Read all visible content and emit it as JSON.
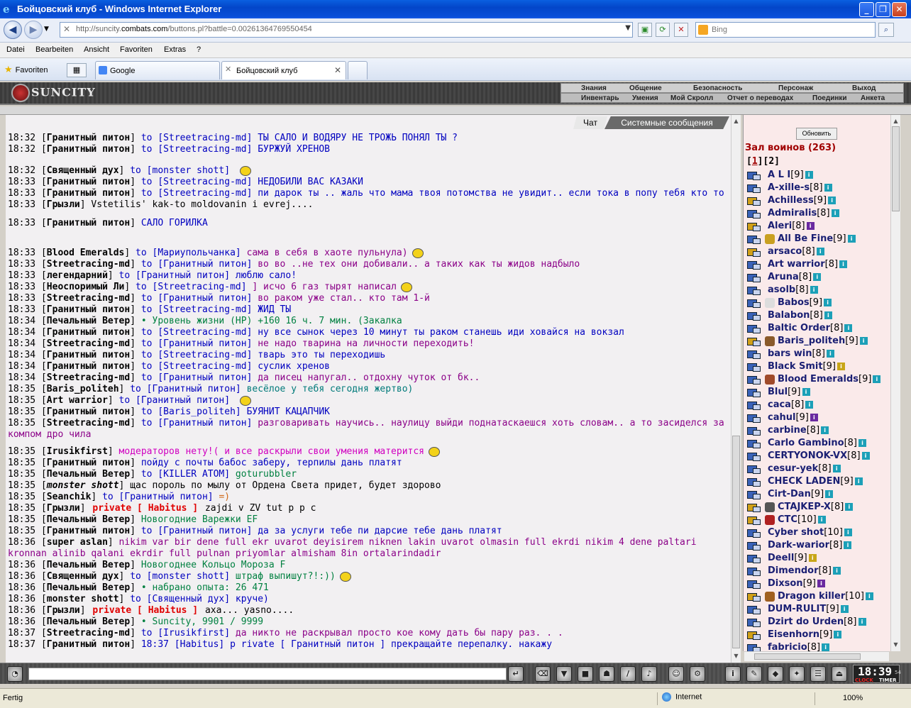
{
  "window": {
    "title": "Бойцовский клуб - Windows Internet Explorer",
    "minimize": "_",
    "maximize": "❐",
    "close": "✕"
  },
  "nav": {
    "back": "◀",
    "forward": "▶",
    "url_prefix": "http://suncity.",
    "url_domain": "combats.com",
    "url_rest": "/buttons.pl?battle=0.00261364769550454",
    "search_placeholder": "Bing"
  },
  "menu": [
    "Datei",
    "Bearbeiten",
    "Ansicht",
    "Favoriten",
    "Extras",
    "?"
  ],
  "favorites_label": "Favoriten",
  "tabs": [
    {
      "label": "Google"
    },
    {
      "label": "Бойцовский клуб"
    }
  ],
  "game": {
    "logo": "SUNCITY",
    "top_menu": [
      "Знания",
      "Общение",
      "Безопасность",
      "Персонаж",
      "Выход"
    ],
    "sub_menu": [
      "Инвентарь",
      "Умения",
      "Мой Скролл",
      "Отчет о переводах",
      "Поединки",
      "Анкета"
    ]
  },
  "chat_tabs": [
    "Чат",
    "Системные сообщения"
  ],
  "chat": [
    {
      "time": "18:32",
      "nick": "Гранитный питон",
      "to": "to [Streetracing-md]",
      "text": "ТЫ САЛО И ВОДЯРУ НЕ ТРОЖЬ ПОНЯЛ ТЫ ?",
      "color": "c-blue"
    },
    {
      "time": "18:32",
      "nick": "Гранитный питон",
      "to": "to [Streetracing-md]",
      "text": "БУРЖУЙ ХРЕНОВ",
      "color": "c-blue"
    },
    {
      "time": "18:32",
      "nick": "Священный дух",
      "to": "to [monster shott]",
      "text": "",
      "color": "c-green"
    },
    {
      "time": "18:33",
      "nick": "Гранитный питон",
      "to": "to [Streetracing-md]",
      "text": "НЕДОБИЛИ ВАС КАЗАКИ",
      "color": "c-blue"
    },
    {
      "time": "18:33",
      "nick": "Гранитный питон",
      "to": "to [Streetracing-md]",
      "text": "пи дарок ты .. жаль что мама твоя потомства не увидит.. если тока в попу тебя кто то",
      "color": "c-blue"
    },
    {
      "time": "18:33",
      "nick": "Грызли",
      "to": "",
      "text": "Vstetilis' kak-to moldovanin i evrej....",
      "color": ""
    },
    {
      "time": "18:33",
      "nick": "Гранитный питон",
      "to": "",
      "text": "САЛО          ГОРИЛКА",
      "color": "c-blue"
    },
    {
      "time": "18:33",
      "nick": "Blood Emeralds",
      "to": "to [Мариупольчанка]",
      "text": "сама в себя в хаоте пульнула)",
      "color": "c-purple"
    },
    {
      "time": "18:33",
      "nick": "Streetracing-md",
      "to": "to [Гранитный питон]",
      "text": "во во ..не тех они добивали.. а таких как ты жидов надбыло",
      "color": "c-purple"
    },
    {
      "time": "18:33",
      "nick": "легендарний",
      "to": "to [Гранитный питон]",
      "text": "люблю сало!",
      "color": "c-blue"
    },
    {
      "time": "18:33",
      "nick": "Неоспоримый Ли",
      "to": "to [Streetracing-md]",
      "text": "] исчо 6 газ тырят написал",
      "color": "c-purple"
    },
    {
      "time": "18:33",
      "nick": "Streetracing-md",
      "to": "to [Гранитный питон]",
      "text": "во раком уже стал.. кто там 1-й",
      "color": "c-purple"
    },
    {
      "time": "18:33",
      "nick": "Гранитный питон",
      "to": "to [Streetracing-md]",
      "text": "ЖИД ТЫ",
      "color": "c-blue"
    },
    {
      "time": "18:34",
      "nick": "Печальный Ветер",
      "to": "",
      "text": "• Уровень жизни (HP) +160 16 ч. 7 мин. (Закалка",
      "color": "c-green"
    },
    {
      "time": "18:34",
      "nick": "Гранитный питон",
      "to": "to [Streetracing-md]",
      "text": "ну все сынок через 10 минут ты раком станешь иди ховайся на вокзал",
      "color": "c-blue"
    },
    {
      "time": "18:34",
      "nick": "Streetracing-md",
      "to": "to [Гранитный питон]",
      "text": "не надо тварина на личности переходить!",
      "color": "c-purple"
    },
    {
      "time": "18:34",
      "nick": "Гранитный питон",
      "to": "to [Streetracing-md]",
      "text": "тварь это ты переходишь",
      "color": "c-blue"
    },
    {
      "time": "18:34",
      "nick": "Гранитный питон",
      "to": "to [Streetracing-md]",
      "text": "суслик хренов",
      "color": "c-blue"
    },
    {
      "time": "18:34",
      "nick": "Streetracing-md",
      "to": "to [Гранитный питон]",
      "text": "да писец напугал.. отдохну чуток от бк..",
      "color": "c-purple"
    },
    {
      "time": "18:35",
      "nick": "Baris_politeh",
      "to": "to [Гранитный питон]",
      "text": "весёлое у тебя сегодня жертво)",
      "color": "c-teal"
    },
    {
      "time": "18:35",
      "nick": "Art warrior",
      "to": "to [Гранитный питон]",
      "text": "",
      "color": "c-magenta"
    },
    {
      "time": "18:35",
      "nick": "Гранитный питон",
      "to": "to [Baris_politeh]",
      "text": "БУЯНИТ КАЦАПЧИК",
      "color": "c-blue"
    },
    {
      "time": "18:35",
      "nick": "Streetracing-md",
      "to": "to [Гранитный питон]",
      "text": "разговаривать научись.. наулицу выйди поднатаскаешся хоть словам.. а то засиделся за компом дро чила",
      "color": "c-purple"
    },
    {
      "time": "18:35",
      "nick": "Irusikfirst",
      "to": "",
      "text": "модераторов нету!( и все раскрыли свои умения матерится",
      "color": "c-magenta"
    },
    {
      "time": "18:35",
      "nick": "Гранитный питон",
      "to": "",
      "text": "пойду с почты бабос заберу, терпилы дань платят",
      "color": "c-blue"
    },
    {
      "time": "18:35",
      "nick": "Печальный Ветер",
      "to": "to [KILLER ATOM]",
      "text": "goturubbler",
      "color": "c-green"
    },
    {
      "time": "18:35",
      "nick": "monster shott",
      "to": "",
      "text": "щас пороль по мылу от Ордена Света придет, будет здорово",
      "color": ""
    },
    {
      "time": "18:35",
      "nick": "Seanchik",
      "to": "to [Гранитный питон]",
      "text": "=)",
      "color": "c-orange"
    },
    {
      "time": "18:35",
      "nick": "Грызли",
      "to": "private [ Habitus ]",
      "text": "zajdi v ZV tut p p c",
      "color": ""
    },
    {
      "time": "18:35",
      "nick": "Печальный Ветер",
      "to": "",
      "text": "Новогодние Варежки EF",
      "color": "c-green"
    },
    {
      "time": "18:35",
      "nick": "Гранитный питон",
      "to": "to [Гранитный питон]",
      "text": "да за услуги тебе пи дарсие тебе дань платят",
      "color": "c-blue"
    },
    {
      "time": "18:36",
      "nick": "super aslan",
      "to": "",
      "text": "nikim var bir dene full ekr uvarot deyisirem niknen lakin uvarot olmasin full ekrdi nikim 4 dene paltari kronnan alinib qalani ekrdir full pulnan priyomlar almisham 8in ortalarindadir",
      "color": "c-purple"
    },
    {
      "time": "18:36",
      "nick": "Печальный Ветер",
      "to": "",
      "text": "Новогоднее Кольцо Мороза F",
      "color": "c-green"
    },
    {
      "time": "18:36",
      "nick": "Священный дух",
      "to": "to [monster shott]",
      "text": "штраф выпишут?!:))",
      "color": "c-green"
    },
    {
      "time": "18:36",
      "nick": "Печальный Ветер",
      "to": "",
      "text": "• набрано опыта: 26 471",
      "color": "c-green"
    },
    {
      "time": "18:36",
      "nick": "monster shott",
      "to": "to [Священный дух]",
      "text": "круче)",
      "color": "c-blue"
    },
    {
      "time": "18:36",
      "nick": "Грызли",
      "to": "private [ Habitus ]",
      "text": "axa... yasno....",
      "color": ""
    },
    {
      "time": "18:36",
      "nick": "Печальный Ветер",
      "to": "",
      "text": "• Suncity, 9901 / 9999",
      "color": "c-green"
    },
    {
      "time": "18:37",
      "nick": "Streetracing-md",
      "to": "to [Irusikfirst]",
      "text": "да никто не раскрывал просто кое кому дать бы пару раз. . .",
      "color": "c-purple"
    },
    {
      "time": "18:37",
      "nick": "Гранитный питон",
      "to": "",
      "text": "18:37 [Habitus] p rivate [ Гранитный питон ] прекращайте перепалку. накажу",
      "color": "c-blue"
    }
  ],
  "users_panel": {
    "refresh_label": "Обновить",
    "hall_title": "Зал воинов (263)",
    "page_1": "1",
    "page_2": "2",
    "users": [
      {
        "name": "A L I",
        "level": "[9]"
      },
      {
        "name": "A-xille-s",
        "level": "[8]"
      },
      {
        "name": "Achilless",
        "level": "[9]"
      },
      {
        "name": "Admiralis",
        "level": "[8]"
      },
      {
        "name": "Aleri",
        "level": "[8]"
      },
      {
        "name": "All Be Fine",
        "level": "[9]"
      },
      {
        "name": "arsaco",
        "level": "[8]"
      },
      {
        "name": "Art warrior",
        "level": "[8]"
      },
      {
        "name": "Aruna",
        "level": "[8]"
      },
      {
        "name": "asolb",
        "level": "[8]"
      },
      {
        "name": "Babos",
        "level": "[9]"
      },
      {
        "name": "Balabon",
        "level": "[8]"
      },
      {
        "name": "Baltic Order",
        "level": "[8]"
      },
      {
        "name": "Baris_politeh",
        "level": "[9]"
      },
      {
        "name": "bars win",
        "level": "[8]"
      },
      {
        "name": "Black Smit",
        "level": "[9]"
      },
      {
        "name": "Blood Emeralds",
        "level": "[9]"
      },
      {
        "name": "Blul",
        "level": "[9]"
      },
      {
        "name": "caca",
        "level": "[8]"
      },
      {
        "name": "cahul",
        "level": "[9]"
      },
      {
        "name": "carbine",
        "level": "[8]"
      },
      {
        "name": "Carlo Gambino",
        "level": "[8]"
      },
      {
        "name": "CERTYONOK-VX",
        "level": "[8]"
      },
      {
        "name": "cesur-yek",
        "level": "[8]"
      },
      {
        "name": "CHECK LADEN",
        "level": "[9]"
      },
      {
        "name": "Cirt-Dan",
        "level": "[9]"
      },
      {
        "name": "CTAJKEP-X",
        "level": "[8]"
      },
      {
        "name": "CTC",
        "level": "[10]"
      },
      {
        "name": "Cyber shot",
        "level": "[10]"
      },
      {
        "name": "Dark-warior",
        "level": "[8]"
      },
      {
        "name": "Deell",
        "level": "[9]"
      },
      {
        "name": "Dimendor",
        "level": "[8]"
      },
      {
        "name": "Dixson",
        "level": "[9]"
      },
      {
        "name": "Dragon killer",
        "level": "[10]"
      },
      {
        "name": "DUM-RULIT",
        "level": "[9]"
      },
      {
        "name": "Dzirt do Urden",
        "level": "[8]"
      },
      {
        "name": "Eisenhorn",
        "level": "[9]"
      },
      {
        "name": "fabricio",
        "level": "[8]"
      }
    ]
  },
  "bottom": {
    "clock": "18:39",
    "clock_sec": "54",
    "clock_label_1": "CLOCK",
    "clock_label_2": "TIMER"
  },
  "status": {
    "text": "Fertig",
    "zone": "Internet",
    "zoom": "100%"
  }
}
